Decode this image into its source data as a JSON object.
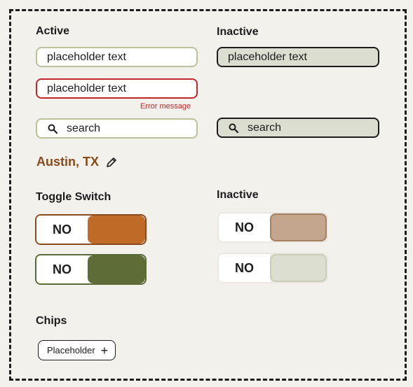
{
  "sections": {
    "active_heading": "Active",
    "inactive_heading": "Inactive",
    "toggle_heading": "Toggle Switch",
    "toggle_inactive_heading": "Inactive",
    "chips_heading": "Chips"
  },
  "inputs": {
    "active_placeholder": "placeholder text",
    "error_placeholder": "placeholder text",
    "error_message": "Error message",
    "inactive_placeholder": "placeholder text",
    "search_active": "search",
    "search_inactive": "search"
  },
  "location": {
    "text": "Austin, TX",
    "edit_icon": "pencil-icon"
  },
  "toggles": {
    "orange_label": "NO",
    "green_label": "NO",
    "tan_label": "NO",
    "sage_label": "NO"
  },
  "chips": {
    "placeholder_label": "Placeholder",
    "add_icon": "plus-icon"
  },
  "colors": {
    "background": "#f3f1ec",
    "active_border": "#b9c29b",
    "error": "#c1272d",
    "inactive_fill": "#dcded1",
    "accent_brown": "#8b4a1b",
    "toggle_orange": "#c06a28",
    "toggle_green": "#5e6d38",
    "toggle_tan": "#c4a68f",
    "toggle_sage": "#dcdecf"
  }
}
